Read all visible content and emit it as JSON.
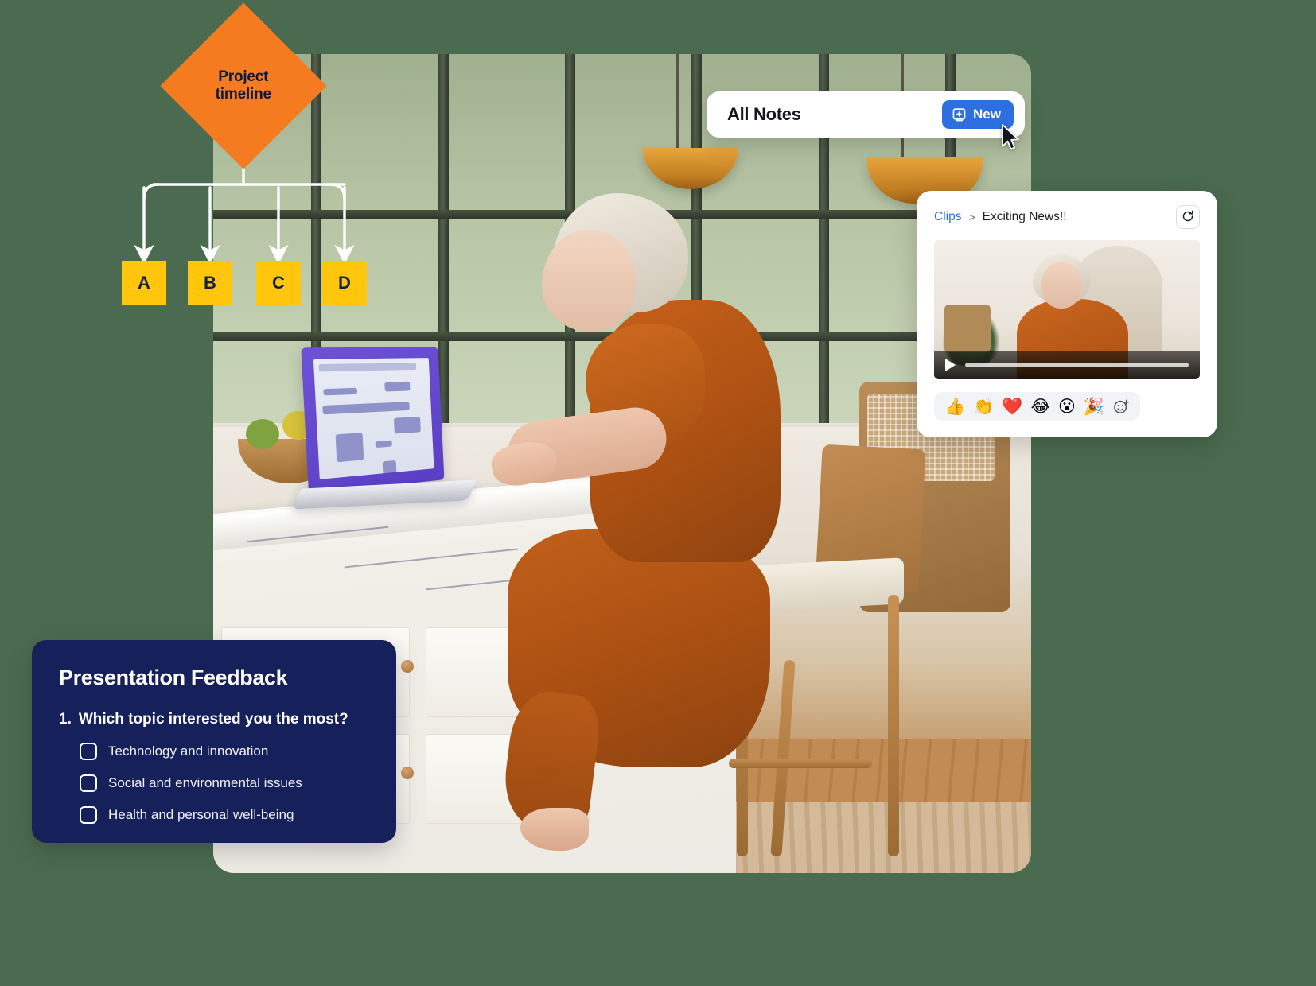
{
  "photo": {
    "alt_description": "Woman in rust-colored outfit sitting on a stool at a marble kitchen island working on a purple laptop in front of large windows"
  },
  "flow_diagram": {
    "root_label": "Project\ntimeline",
    "root_line_1": "Project",
    "root_line_2": "timeline",
    "root_color": "#f47b20",
    "node_color": "#ffc60b",
    "nodes": [
      {
        "label": "A"
      },
      {
        "label": "B"
      },
      {
        "label": "C"
      },
      {
        "label": "D"
      }
    ]
  },
  "notes_card": {
    "title": "All Notes",
    "new_button_label": "New",
    "new_button_icon": "note-plus-icon",
    "accent_color": "#2d6fe0",
    "cursor_icon": "mouse-pointer-icon"
  },
  "clips_card": {
    "breadcrumb_root": "Clips",
    "breadcrumb_separator": ">",
    "breadcrumb_current": "Exciting News!!",
    "refresh_icon": "refresh-icon",
    "link_color": "#2d6fe0",
    "video": {
      "play_icon": "play-icon",
      "progress_percent": 0
    },
    "reactions": [
      {
        "name": "thumbs-up-emoji",
        "glyph": "👍"
      },
      {
        "name": "clapping-hands-emoji",
        "glyph": "👏"
      },
      {
        "name": "red-heart-emoji",
        "glyph": "❤️"
      },
      {
        "name": "laughing-tears-emoji",
        "glyph": "😂"
      },
      {
        "name": "surprised-face-emoji",
        "glyph": "😮"
      },
      {
        "name": "party-popper-emoji",
        "glyph": "🎉"
      }
    ],
    "add_reaction_icon": "add-reaction-icon"
  },
  "feedback_card": {
    "title": "Presentation Feedback",
    "question_number": "1.",
    "question_text": "Which topic interested you the most?",
    "background_color": "#16215c",
    "options": [
      {
        "label": "Technology and innovation",
        "checked": false
      },
      {
        "label": "Social and environmental issues",
        "checked": false
      },
      {
        "label": "Health and personal well-being",
        "checked": false
      }
    ]
  },
  "theme": {
    "page_background": "#4a6b4f"
  }
}
